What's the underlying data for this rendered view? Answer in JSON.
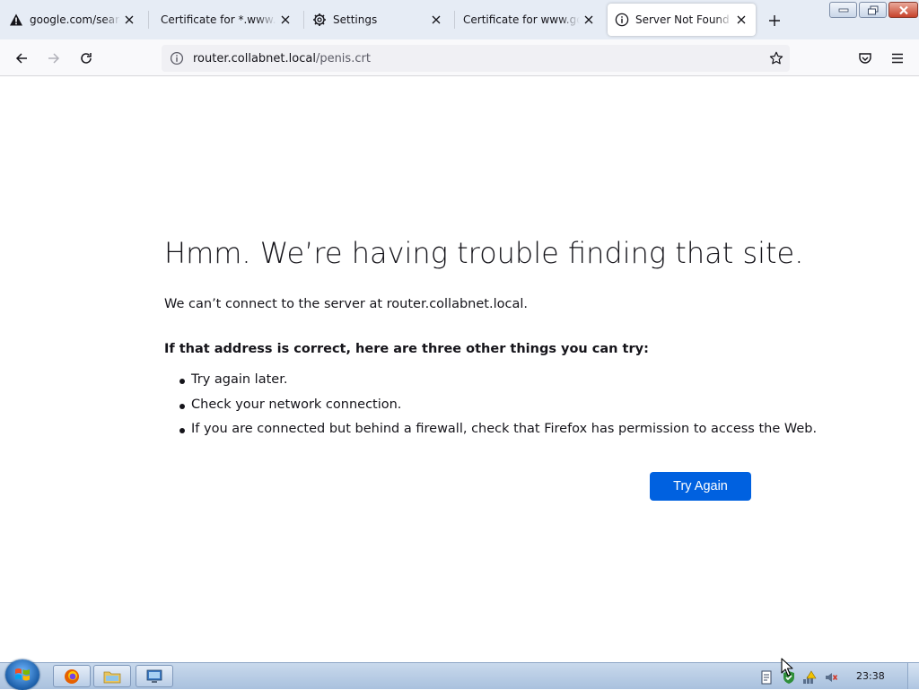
{
  "tabs": [
    {
      "label": "google.com/search?q",
      "icon": "warning-icon"
    },
    {
      "label": "Certificate for *.www.mozilla",
      "icon": ""
    },
    {
      "label": "Settings",
      "icon": "gear-icon"
    },
    {
      "label": "Certificate for www.google",
      "icon": ""
    },
    {
      "label": "Server Not Found",
      "icon": "info-icon",
      "active": true
    }
  ],
  "urlbar": {
    "host": "router.collabnet.local",
    "path": "/penis.crt"
  },
  "error": {
    "title": "Hmm. We’re having trouble finding that site.",
    "description": "We can’t connect to the server at router.collabnet.local.",
    "subheading": "If that address is correct, here are three other things you can try:",
    "suggestions": [
      "Try again later.",
      "Check your network connection.",
      "If you are connected but behind a firewall, check that Firefox has permission to access the Web."
    ],
    "button_label": "Try Again"
  },
  "taskbar": {
    "clock": "23:38",
    "pinned": [
      "firefox-icon",
      "folder-icon",
      "remote-desktop-icon"
    ],
    "tray": [
      "document-icon",
      "shield-check-icon",
      "network-icon",
      "speaker-muted-icon"
    ]
  },
  "colors": {
    "accent": "#0061e0",
    "tabstrip": "#e6ecf5",
    "navbar": "#f9f9fb",
    "text": "#15141a"
  }
}
